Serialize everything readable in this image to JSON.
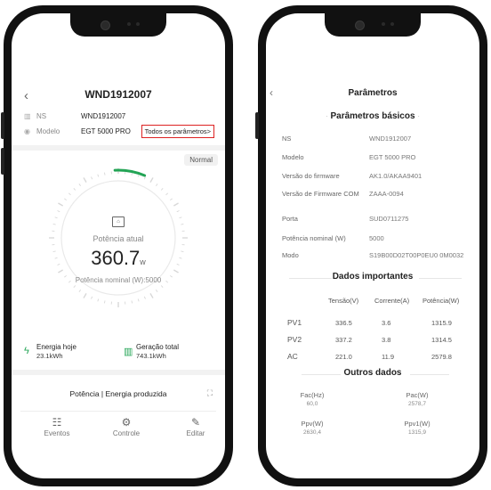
{
  "left": {
    "title": "WND1912007",
    "back_icon": "‹",
    "ns_label": "NS",
    "ns_value": "WND1912007",
    "model_label": "Modelo",
    "model_value": "EGT 5000 PRO",
    "all_params": "Todos os parâmetros>",
    "status": "Normal",
    "power_label": "Potência atual",
    "power_value": "360.7",
    "power_unit": "w",
    "nominal": "Potência nominal (W):5000",
    "energy_today_label": "Energia hoje",
    "energy_today_value": "23.1kWh",
    "total_gen_label": "Geração total",
    "total_gen_value": "743.1kWh",
    "chart_title": "Potência | Energia produzida",
    "nav": [
      {
        "label": "Eventos",
        "icon": "events-icon"
      },
      {
        "label": "Controle",
        "icon": "gear-icon"
      },
      {
        "label": "Editar",
        "icon": "edit-icon"
      }
    ],
    "accent": "#23a455",
    "highlight": "#dd2222"
  },
  "right": {
    "title": "Parâmetros",
    "basic_title": "Parâmetros básicos",
    "basic": [
      {
        "k": "NS",
        "v": "WND1912007"
      },
      {
        "k": "Modelo",
        "v": "EGT 5000 PRO"
      },
      {
        "k": "Versão do firmware",
        "v": "AK1.0/AKAA9401"
      },
      {
        "k": "Versão de Firmware COM",
        "v": "ZAAA-0094"
      },
      {
        "k": "Porta",
        "v": "SUD0711275"
      },
      {
        "k": "Potência nominal (W)",
        "v": "5000"
      },
      {
        "k": "Modo",
        "v": "S19B00D02T00P0EU0 0M0032"
      }
    ],
    "important_title": "Dados importantes",
    "table_headers": [
      "Tensão(V)",
      "Corrente(A)",
      "Potência(W)"
    ],
    "table_rows": [
      {
        "name": "PV1",
        "cells": [
          "336.5",
          "3.6",
          "1315.9"
        ]
      },
      {
        "name": "PV2",
        "cells": [
          "337.2",
          "3.8",
          "1314.5"
        ]
      },
      {
        "name": "AC",
        "cells": [
          "221.0",
          "11.9",
          "2579.8"
        ]
      }
    ],
    "other_title": "Outros dados",
    "other": [
      {
        "k": "Fac(Hz)",
        "v": "60,0"
      },
      {
        "k": "Pac(W)",
        "v": "2578,7"
      },
      {
        "k": "Ppv(W)",
        "v": "2630,4"
      },
      {
        "k": "Ppv1(W)",
        "v": "1315,9"
      }
    ]
  }
}
